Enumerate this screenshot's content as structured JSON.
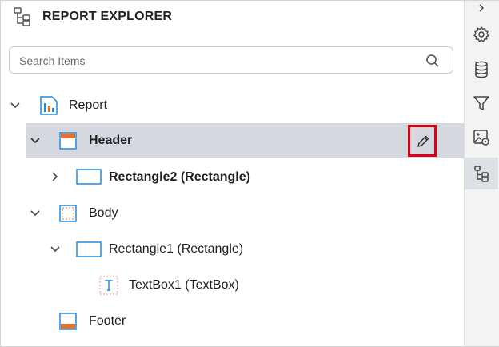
{
  "panel": {
    "title": "REPORT EXPLORER",
    "search": {
      "placeholder": "Search Items",
      "value": ""
    }
  },
  "tree": [
    {
      "label": "Report",
      "expanded": true,
      "bold": false
    },
    {
      "label": "Header",
      "expanded": true,
      "bold": true,
      "selected": true
    },
    {
      "label": "Rectangle2 (Rectangle)",
      "expanded": false,
      "bold": true
    },
    {
      "label": "Body",
      "expanded": true,
      "bold": false
    },
    {
      "label": "Rectangle1 (Rectangle)",
      "expanded": true,
      "bold": false
    },
    {
      "label": "TextBox1 (TextBox)",
      "bold": false
    },
    {
      "label": "Footer",
      "bold": false
    }
  ],
  "rail": {
    "items": [
      "collapse-chevron-icon",
      "settings-icon",
      "data-source-icon",
      "filter-icon",
      "image-manager-icon",
      "report-explorer-icon"
    ],
    "active": "report-explorer-icon"
  },
  "colors": {
    "accent": "#1e88e5",
    "orange": "#e8702a",
    "highlight_box": "#e0000f",
    "selected_row": "#d5d9df"
  }
}
